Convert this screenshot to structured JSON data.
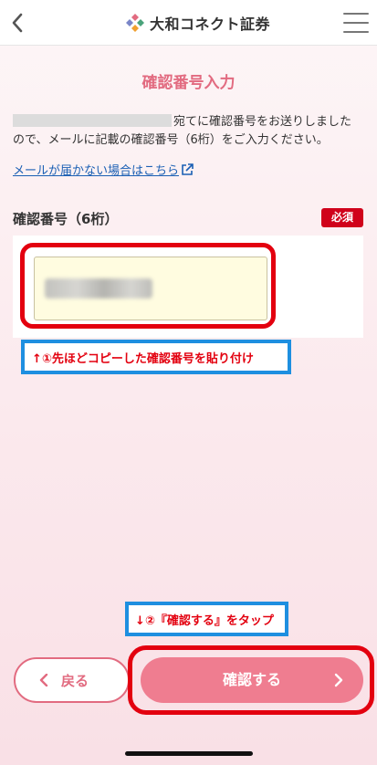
{
  "header": {
    "logo_text": "大和コネクト証券"
  },
  "page": {
    "title": "確認番号入力",
    "desc_line1_suffix": "宛てに確認番号をお送りしました",
    "desc_line2": "ので、メールに記載の確認番号（6桁）をご入力ください。",
    "help_link": "メールが届かない場合はこちら"
  },
  "form": {
    "label": "確認番号（6桁）",
    "required_badge": "必須"
  },
  "annotations": {
    "step1": "↑①先ほどコピーした確認番号を貼り付け",
    "step2": "↓②『確認する』をタップ"
  },
  "buttons": {
    "back": "戻る",
    "confirm": "確認する"
  },
  "colors": {
    "accent": "#e26b80",
    "primary_button": "#ef7d90",
    "required": "#d0021b",
    "annotation_red": "#e3000f",
    "annotation_blue": "#1e8fe0",
    "link": "#1a5fb4"
  }
}
